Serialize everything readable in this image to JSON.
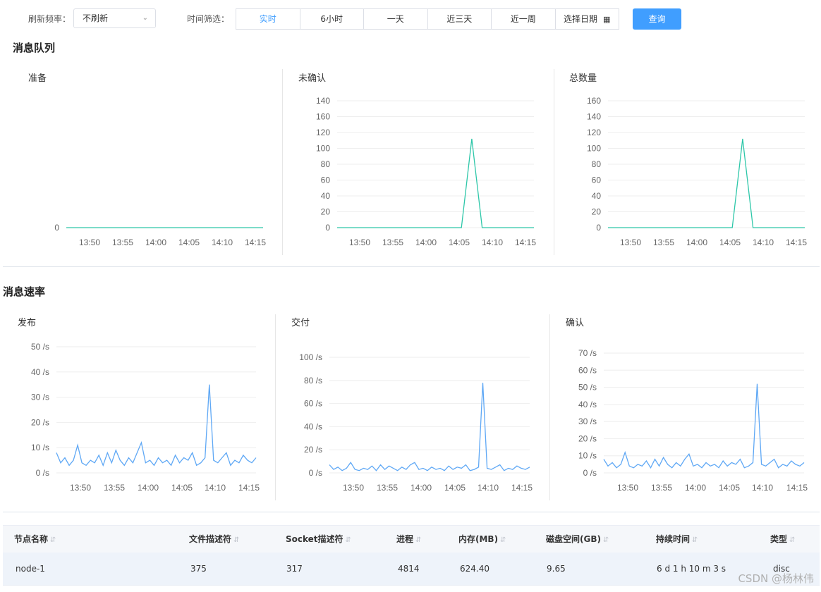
{
  "toolbar": {
    "refresh_label": "刷新频率：",
    "refresh_value": "不刷新",
    "time_label": "时间筛选：",
    "ranges": [
      "实时",
      "6小时",
      "一天",
      "近三天",
      "近一周",
      "选择日期"
    ],
    "active_range": "实时",
    "query_label": "查询"
  },
  "sections": {
    "queue_title": "消息队列",
    "rate_title": "消息速率"
  },
  "charts": {
    "ready_title": "准备",
    "unacked_title": "未确认",
    "total_title": "总数量",
    "publish_title": "发布",
    "deliver_title": "交付",
    "ack_title": "确认"
  },
  "chart_data": [
    {
      "type": "line",
      "title": "准备",
      "x_ticks": [
        "13:50",
        "13:55",
        "14:00",
        "14:05",
        "14:10",
        "14:15"
      ],
      "y_ticks": [
        "0"
      ],
      "ylim": [
        0,
        0
      ],
      "series": [
        {
          "values": [
            0,
            0,
            0,
            0,
            0,
            0
          ]
        }
      ],
      "color": "#2ec7a9"
    },
    {
      "type": "line",
      "title": "未确认",
      "x_ticks": [
        "13:50",
        "13:55",
        "14:00",
        "14:05",
        "14:10",
        "14:15"
      ],
      "y_ticks": [
        "0",
        "20",
        "40",
        "60",
        "80",
        "100",
        "120",
        "160",
        "140"
      ],
      "ylim": [
        0,
        160
      ],
      "series": [
        {
          "values": [
            0,
            0,
            0,
            0,
            0,
            0,
            0,
            0,
            0,
            0,
            0,
            0,
            0,
            112,
            0,
            0,
            0,
            0,
            0,
            0
          ]
        }
      ],
      "color": "#2ec7a9"
    },
    {
      "type": "line",
      "title": "总数量",
      "x_ticks": [
        "13:50",
        "13:55",
        "14:00",
        "14:05",
        "14:10",
        "14:15"
      ],
      "y_ticks": [
        "0",
        "20",
        "40",
        "60",
        "80",
        "100",
        "120",
        "140",
        "160"
      ],
      "ylim": [
        0,
        160
      ],
      "series": [
        {
          "values": [
            0,
            0,
            0,
            0,
            0,
            0,
            0,
            0,
            0,
            0,
            0,
            0,
            0,
            112,
            0,
            0,
            0,
            0,
            0,
            0
          ]
        }
      ],
      "color": "#2ec7a9"
    },
    {
      "type": "line",
      "title": "发布",
      "x_ticks": [
        "13:50",
        "13:55",
        "14:00",
        "14:05",
        "14:10",
        "14:15"
      ],
      "y_ticks": [
        "0 /s",
        "10 /s",
        "20 /s",
        "30 /s",
        "40 /s",
        "50 /s"
      ],
      "ylim": [
        0,
        50
      ],
      "series": [
        {
          "values": [
            8,
            4,
            6,
            3,
            5,
            11,
            4,
            3,
            5,
            4,
            7,
            3,
            8,
            4,
            9,
            5,
            3,
            6,
            4,
            8,
            12,
            4,
            5,
            3,
            6,
            4,
            5,
            3,
            7,
            4,
            6,
            5,
            8,
            3,
            4,
            6,
            35,
            5,
            4,
            6,
            8,
            3,
            5,
            4,
            7,
            5,
            4,
            6
          ]
        }
      ],
      "color": "#5fa8f5"
    },
    {
      "type": "line",
      "title": "交付",
      "x_ticks": [
        "13:50",
        "13:55",
        "14:00",
        "14:05",
        "14:10",
        "14:15"
      ],
      "y_ticks": [
        "0 /s",
        "20 /s",
        "40 /s",
        "60 /s",
        "80 /s",
        "100 /s"
      ],
      "ylim": [
        0,
        100
      ],
      "series": [
        {
          "values": [
            7,
            3,
            5,
            2,
            4,
            9,
            3,
            2,
            4,
            3,
            6,
            2,
            7,
            3,
            6,
            4,
            2,
            5,
            3,
            7,
            9,
            3,
            4,
            2,
            5,
            3,
            4,
            2,
            6,
            3,
            5,
            4,
            7,
            2,
            3,
            5,
            78,
            4,
            3,
            5,
            7,
            2,
            4,
            3,
            6,
            4,
            3,
            5
          ]
        }
      ],
      "color": "#5fa8f5"
    },
    {
      "type": "line",
      "title": "确认",
      "x_ticks": [
        "13:50",
        "13:55",
        "14:00",
        "14:05",
        "14:10",
        "14:15"
      ],
      "y_ticks": [
        "0 /s",
        "10 /s",
        "20 /s",
        "30 /s",
        "40 /s",
        "50 /s",
        "60 /s",
        "70 /s"
      ],
      "ylim": [
        0,
        70
      ],
      "series": [
        {
          "values": [
            8,
            4,
            6,
            3,
            5,
            12,
            4,
            3,
            5,
            4,
            7,
            3,
            8,
            4,
            9,
            5,
            3,
            6,
            4,
            8,
            11,
            4,
            5,
            3,
            6,
            4,
            5,
            3,
            7,
            4,
            6,
            5,
            8,
            3,
            4,
            6,
            52,
            5,
            4,
            6,
            8,
            3,
            5,
            4,
            7,
            5,
            4,
            6
          ]
        }
      ],
      "color": "#5fa8f5"
    }
  ],
  "table": {
    "columns": [
      "节点名称",
      "文件描述符",
      "Socket描述符",
      "进程",
      "内存(MB)",
      "磁盘空间(GB)",
      "持续时间",
      "类型"
    ],
    "rows": [
      [
        "node-1",
        "375",
        "317",
        "4814",
        "624.40",
        "9.65",
        "6 d 1 h 10 m 3 s",
        "disc"
      ]
    ]
  },
  "watermark": "CSDN @杨林伟"
}
